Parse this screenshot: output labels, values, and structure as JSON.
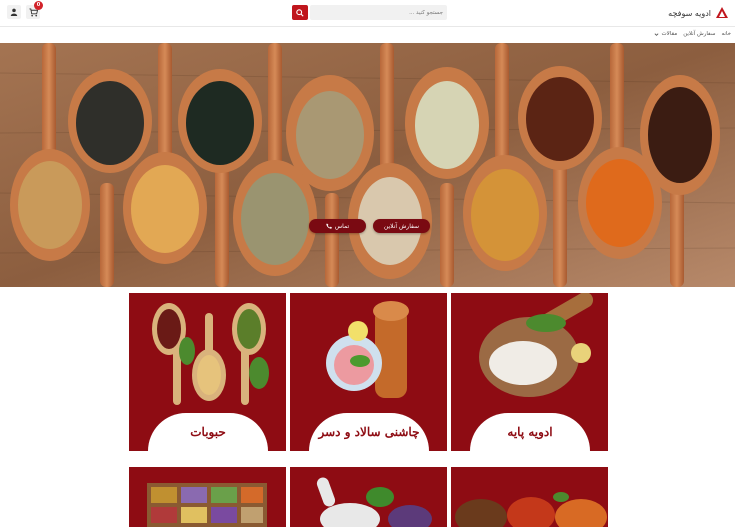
{
  "header": {
    "brand_name": "ادویه سوفچه",
    "search_placeholder": "جستجو کنید ...",
    "cart_count": "0"
  },
  "nav": {
    "items": [
      {
        "label": "خانه"
      },
      {
        "label": "سفارش آنلاین"
      },
      {
        "label": "مقالات"
      }
    ]
  },
  "hero": {
    "order_label": "سفارش آنلاین",
    "contact_label": "تماس"
  },
  "cards": [
    {
      "label": "ادویه پایه"
    },
    {
      "label": "چاشنی سالاد و دسر"
    },
    {
      "label": "حبوبات"
    }
  ],
  "colors": {
    "brand_red": "#c0161d",
    "card_maroon": "#8e0c13",
    "cta_dark": "#7a0a12"
  }
}
